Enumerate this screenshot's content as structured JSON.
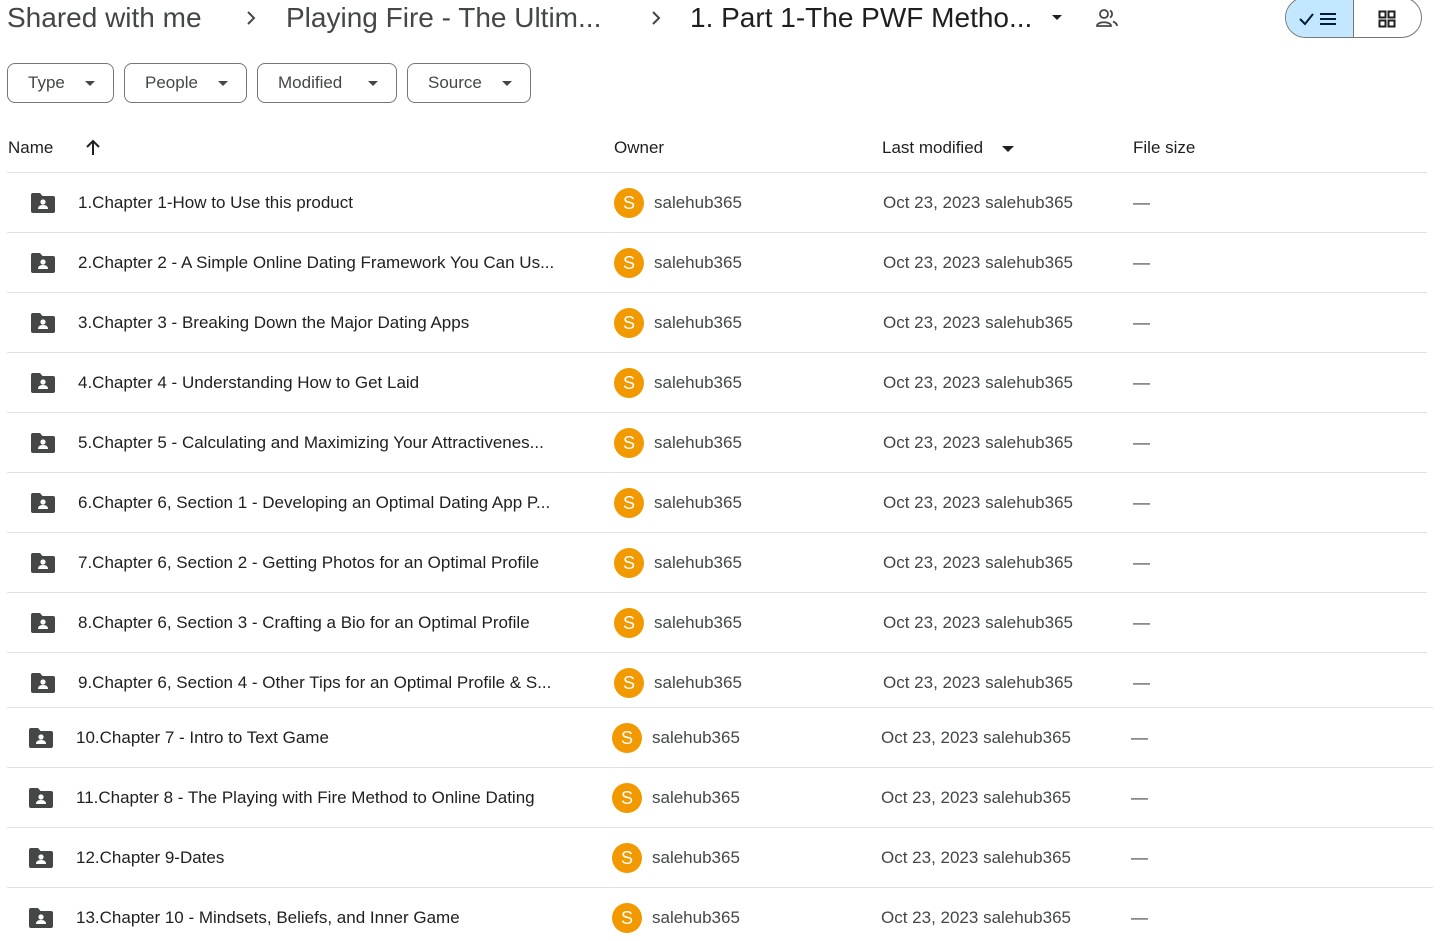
{
  "breadcrumb": {
    "root": "Shared with me",
    "parent": "Playing Fire - The Ultim...",
    "current": "1. Part 1-The PWF Metho..."
  },
  "icons": {
    "separator": "chevron-right-icon",
    "dropdown": "caret-down-icon",
    "shared": "people-icon",
    "list_view": "checkmark-list-icon",
    "grid_view": "grid-icon",
    "folder": "shared-folder-icon",
    "sort": "arrow-up-icon"
  },
  "filters": [
    {
      "label": "Type"
    },
    {
      "label": "People"
    },
    {
      "label": "Modified"
    },
    {
      "label": "Source"
    }
  ],
  "columns": {
    "name": "Name",
    "owner": "Owner",
    "last_modified": "Last modified",
    "file_size": "File size"
  },
  "colors": {
    "avatar": "#f29900",
    "view_toggle_active": "#c2e7ff",
    "divider": "#e1e3e1"
  },
  "rows": [
    {
      "name": "1.Chapter 1-How to Use this product",
      "owner_initial": "S",
      "owner": "salehub365",
      "modified": "Oct 23, 2023 salehub365",
      "size": "—"
    },
    {
      "name": "2.Chapter 2 - A Simple Online Dating Framework You Can Us...",
      "owner_initial": "S",
      "owner": "salehub365",
      "modified": "Oct 23, 2023 salehub365",
      "size": "—"
    },
    {
      "name": "3.Chapter 3 - Breaking Down the Major Dating Apps",
      "owner_initial": "S",
      "owner": "salehub365",
      "modified": "Oct 23, 2023 salehub365",
      "size": "—"
    },
    {
      "name": "4.Chapter 4 - Understanding How to Get Laid",
      "owner_initial": "S",
      "owner": "salehub365",
      "modified": "Oct 23, 2023 salehub365",
      "size": "—"
    },
    {
      "name": "5.Chapter 5 - Calculating and Maximizing Your Attractivenes...",
      "owner_initial": "S",
      "owner": "salehub365",
      "modified": "Oct 23, 2023 salehub365",
      "size": "—"
    },
    {
      "name": "6.Chapter 6, Section 1 - Developing an Optimal Dating App P...",
      "owner_initial": "S",
      "owner": "salehub365",
      "modified": "Oct 23, 2023 salehub365",
      "size": "—"
    },
    {
      "name": "7.Chapter 6, Section 2 - Getting Photos for an Optimal Profile",
      "owner_initial": "S",
      "owner": "salehub365",
      "modified": "Oct 23, 2023 salehub365",
      "size": "—"
    },
    {
      "name": "8.Chapter 6, Section 3 - Crafting a Bio for an Optimal Profile",
      "owner_initial": "S",
      "owner": "salehub365",
      "modified": "Oct 23, 2023 salehub365",
      "size": "—"
    },
    {
      "name": "9.Chapter 6, Section 4 - Other Tips for an Optimal Profile & S...",
      "owner_initial": "S",
      "owner": "salehub365",
      "modified": "Oct 23, 2023 salehub365",
      "size": "—"
    },
    {
      "name": "10.Chapter 7 - Intro to Text Game",
      "owner_initial": "S",
      "owner": "salehub365",
      "modified": "Oct 23, 2023 salehub365",
      "size": "—"
    },
    {
      "name": "11.Chapter 8 - The Playing with Fire Method to Online Dating",
      "owner_initial": "S",
      "owner": "salehub365",
      "modified": "Oct 23, 2023 salehub365",
      "size": "—"
    },
    {
      "name": "12.Chapter 9-Dates",
      "owner_initial": "S",
      "owner": "salehub365",
      "modified": "Oct 23, 2023 salehub365",
      "size": "—"
    },
    {
      "name": "13.Chapter 10 - Mindsets, Beliefs, and Inner Game",
      "owner_initial": "S",
      "owner": "salehub365",
      "modified": "Oct 23, 2023 salehub365",
      "size": "—"
    }
  ]
}
